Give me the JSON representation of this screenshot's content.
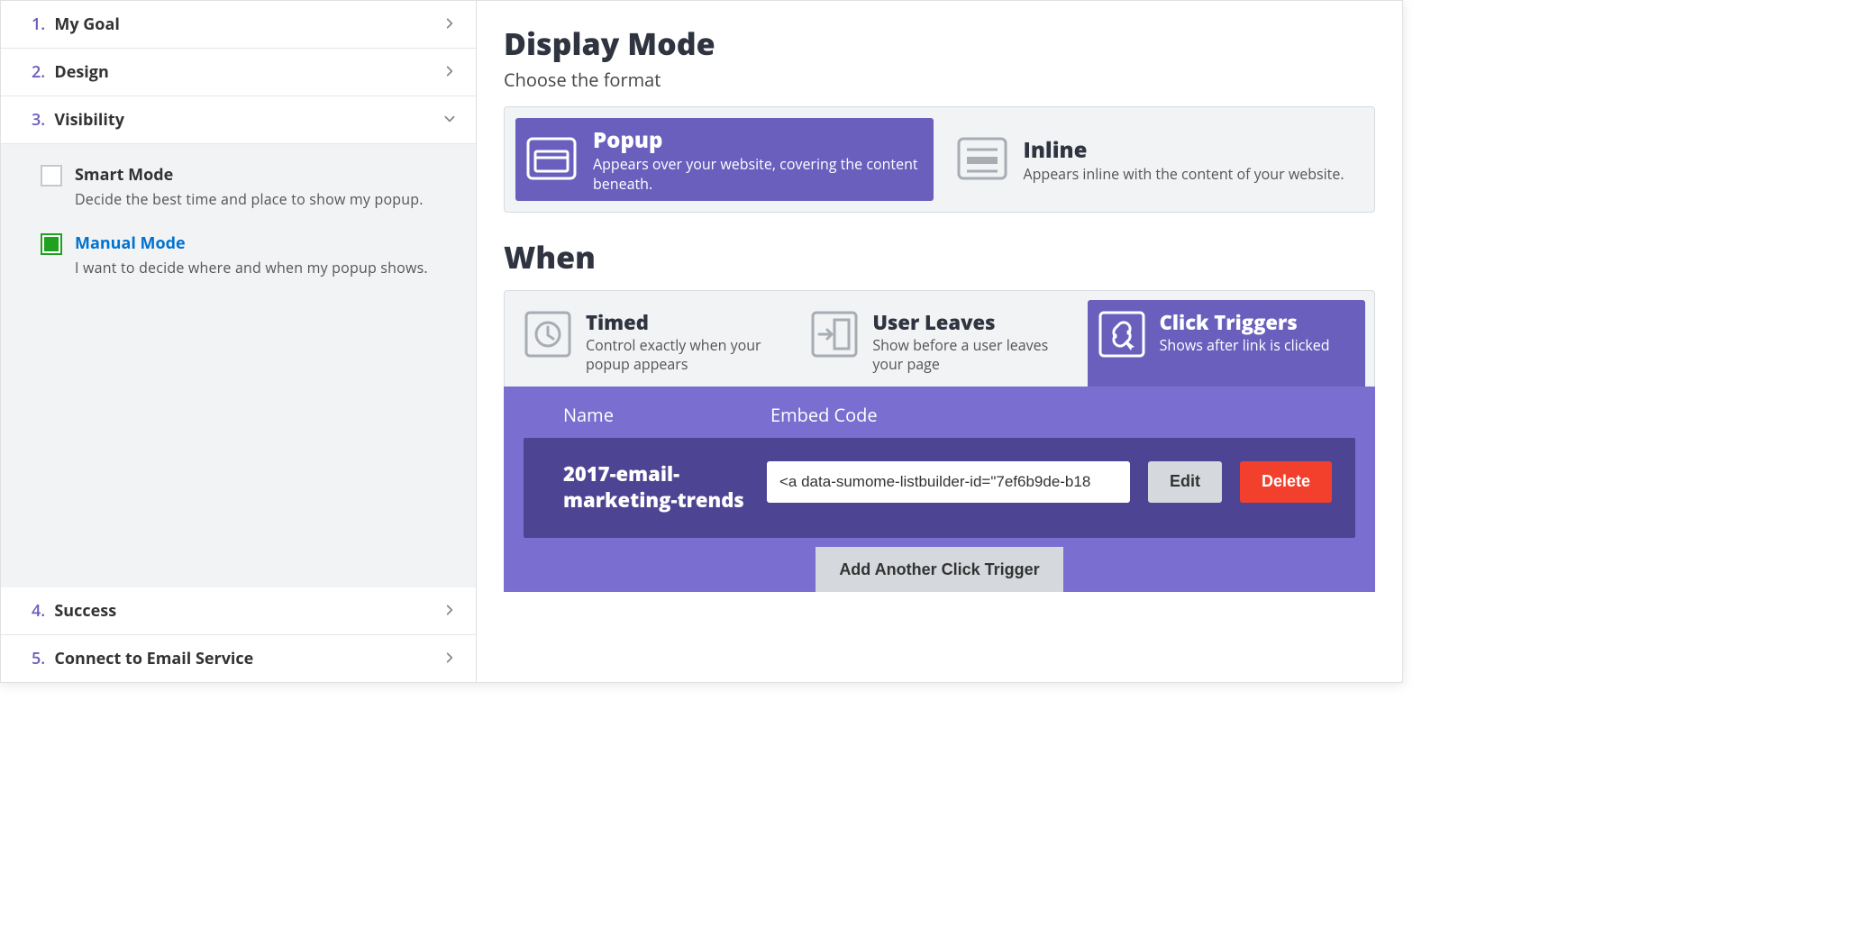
{
  "sidebar": {
    "items": [
      {
        "num": "1.",
        "label": "My Goal",
        "expanded": false
      },
      {
        "num": "2.",
        "label": "Design",
        "expanded": false
      },
      {
        "num": "3.",
        "label": "Visibility",
        "expanded": true
      },
      {
        "num": "4.",
        "label": "Success",
        "expanded": false
      },
      {
        "num": "5.",
        "label": "Connect to Email Service",
        "expanded": false
      }
    ],
    "modes": {
      "smart": {
        "title": "Smart Mode",
        "desc": "Decide the best time and place to show my popup.",
        "selected": false
      },
      "manual": {
        "title": "Manual Mode",
        "desc": "I want to decide where and when my popup shows.",
        "selected": true
      }
    }
  },
  "display_mode": {
    "heading": "Display Mode",
    "subtitle": "Choose the format",
    "options": {
      "popup": {
        "title": "Popup",
        "desc": "Appears over your website, covering the content beneath.",
        "active": true
      },
      "inline": {
        "title": "Inline",
        "desc": "Appears inline with the content of your website.",
        "active": false
      }
    }
  },
  "when": {
    "heading": "When",
    "tabs": {
      "timed": {
        "title": "Timed",
        "desc": "Control exactly when your popup appears"
      },
      "user_leaves": {
        "title": "User Leaves",
        "desc": "Show before a user leaves your page"
      },
      "click_triggers": {
        "title": "Click Triggers",
        "desc": "Shows after link is clicked"
      }
    },
    "columns": {
      "name": "Name",
      "embed": "Embed Code"
    },
    "triggers": [
      {
        "name": "2017-email-marketing-trends",
        "embed": "<a data-sumome-listbuilder-id=\"7ef6b9de-b18"
      }
    ],
    "buttons": {
      "edit": "Edit",
      "delete": "Delete",
      "add": "Add Another Click Trigger"
    }
  }
}
